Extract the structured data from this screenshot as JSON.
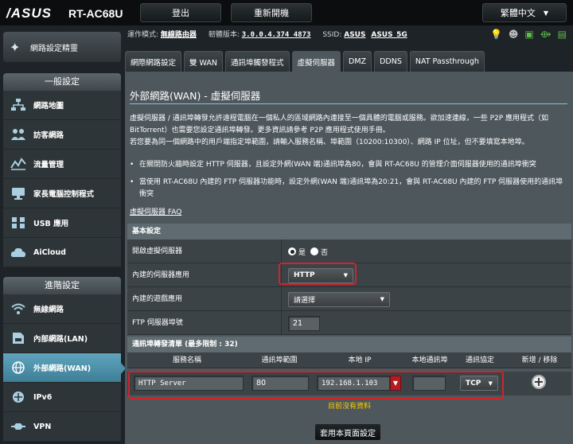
{
  "header": {
    "brand": "/ASUS",
    "model": "RT-AC68U",
    "logout": "登出",
    "reboot": "重新開機",
    "language": "繁體中文"
  },
  "sidebar": {
    "quick_setup": "網路設定精靈",
    "general_title": "一般設定",
    "general_items": [
      {
        "label": "網路地圖",
        "icon": "network-map-icon"
      },
      {
        "label": "訪客網路",
        "icon": "guest-network-icon"
      },
      {
        "label": "流量管理",
        "icon": "traffic-manager-icon"
      },
      {
        "label": "家長電腦控制程式",
        "icon": "parental-control-icon"
      },
      {
        "label": "USB 應用",
        "icon": "usb-app-icon"
      },
      {
        "label": "AiCloud",
        "icon": "aicloud-icon"
      }
    ],
    "advanced_title": "進階設定",
    "advanced_items": [
      {
        "label": "無線網路",
        "icon": "wireless-icon"
      },
      {
        "label": "內部網路(LAN)",
        "icon": "lan-icon"
      },
      {
        "label": "外部網路(WAN)",
        "icon": "wan-icon",
        "active": true
      },
      {
        "label": "IPv6",
        "icon": "ipv6-icon"
      },
      {
        "label": "VPN",
        "icon": "vpn-icon"
      }
    ]
  },
  "infobar": {
    "mode_label": "運作模式:",
    "mode_value": "無線路由器",
    "fw_label": "韌體版本:",
    "fw_value": "3.0.0.4.374_4873",
    "ssid_label": "SSID:",
    "ssid_1": "ASUS",
    "ssid_2": "ASUS_5G"
  },
  "tabs": [
    {
      "label": "網際網路設定"
    },
    {
      "label": "雙 WAN"
    },
    {
      "label": "通訊埠觸發程式"
    },
    {
      "label": "虛擬伺服器",
      "active": true
    },
    {
      "label": "DMZ"
    },
    {
      "label": "DDNS"
    },
    {
      "label": "NAT Passthrough"
    }
  ],
  "page": {
    "title": "外部網路(WAN) - 虛擬伺服器",
    "desc_1": "虛擬伺服器 / 通訊埠轉發允許遠程電腦在一個私人的區域網路內連接至一個具體的電腦或服務。欲加速連線，一些 P2P 應用程式（如",
    "desc_2": "BitTorrent）也需要您設定通訊埠轉發。更多資訊請參考 P2P 應用程式使用手冊。",
    "desc_3": "若您要為同一個網路中的用戶端指定埠範圍，請輸入服務名稱、埠範圍（10200:10300）、網路 IP 位址，但不要填寫本地埠。",
    "bullet_1": "在關閉防火牆時設定 HTTP 伺服器，且設定外網(WAN 端)通訊埠為80，會與 RT-AC68U 的管理介面伺服器使用的通訊埠衝突",
    "bullet_2": "當使用 RT-AC68U 內建的 FTP 伺服器功能時，設定外網(WAN 端)通訊埠為20:21，會與 RT-AC68U 內建的 FTP 伺服器使用的通訊埠衝突",
    "faq": "虛擬伺服器 FAQ"
  },
  "basic": {
    "title": "基本設定",
    "enable_label": "開啟虛擬伺服器",
    "yes": "是",
    "no": "否",
    "famous_server_label": "內建的伺服器應用",
    "famous_server_value": "HTTP",
    "famous_game_label": "內建的遊戲應用",
    "famous_game_value": "請選擇",
    "ftp_port_label": "FTP 伺服器埠號",
    "ftp_port_value": "21"
  },
  "list": {
    "title": "通訊埠轉發清單 (最多限制 : 32)",
    "columns": [
      "服務名稱",
      "通訊埠範圍",
      "本地 IP",
      "本地通訊埠",
      "通訊協定",
      "新增 / 移除"
    ],
    "new_row": {
      "service": "HTTP Server",
      "port_range": "80",
      "local_ip": "192.168.1.103",
      "local_port": "",
      "protocol": "TCP"
    },
    "empty": "目前沒有資料"
  },
  "apply": "套用本頁面設定",
  "colors": {
    "accent": "#83c3d8",
    "highlight": "#d2232a",
    "nodata": "#ffcc00"
  }
}
